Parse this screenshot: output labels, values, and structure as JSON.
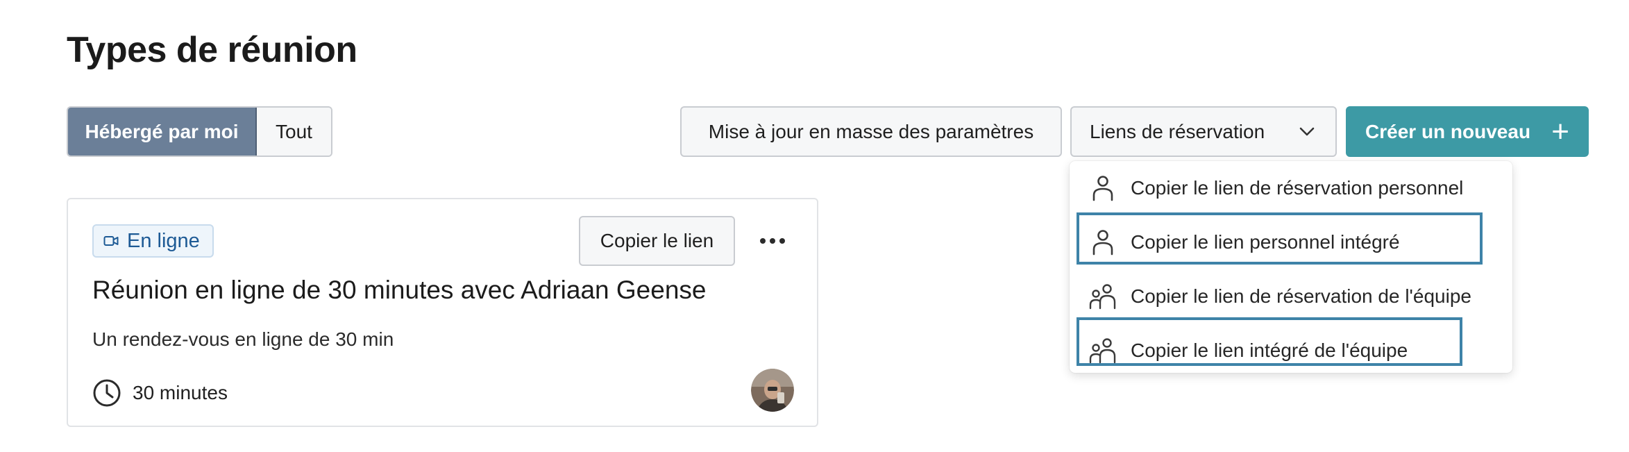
{
  "page": {
    "title": "Types de réunion"
  },
  "filters": {
    "hosted_by_me": "Hébergé par moi",
    "all": "Tout"
  },
  "toolbar": {
    "bulk_update": "Mise à jour en masse des paramètres",
    "booking_links": "Liens de réservation",
    "create_new": "Créer un nouveau",
    "create_icon": "plus-icon",
    "dropdown_icon": "chevron-down-icon"
  },
  "booking_menu": {
    "items": [
      {
        "label": "Copier le lien de réservation personnel",
        "icon": "person-icon"
      },
      {
        "label": "Copier le lien personnel intégré",
        "icon": "person-icon"
      },
      {
        "label": "Copier le lien de réservation de l'équipe",
        "icon": "team-icon"
      },
      {
        "label": "Copier le lien intégré de l'équipe",
        "icon": "team-icon"
      }
    ]
  },
  "card": {
    "badge": "En ligne",
    "copy_link": "Copier le lien",
    "title": "Réunion en ligne de 30 minutes avec Adriaan Geense",
    "description": "Un rendez-vous en ligne de 30 min",
    "duration": "30 minutes"
  },
  "colors": {
    "primary_teal": "#3d9aa5",
    "active_segment": "#6b7f98",
    "badge_text": "#1d5a95",
    "highlight_border": "#3e83a8"
  }
}
